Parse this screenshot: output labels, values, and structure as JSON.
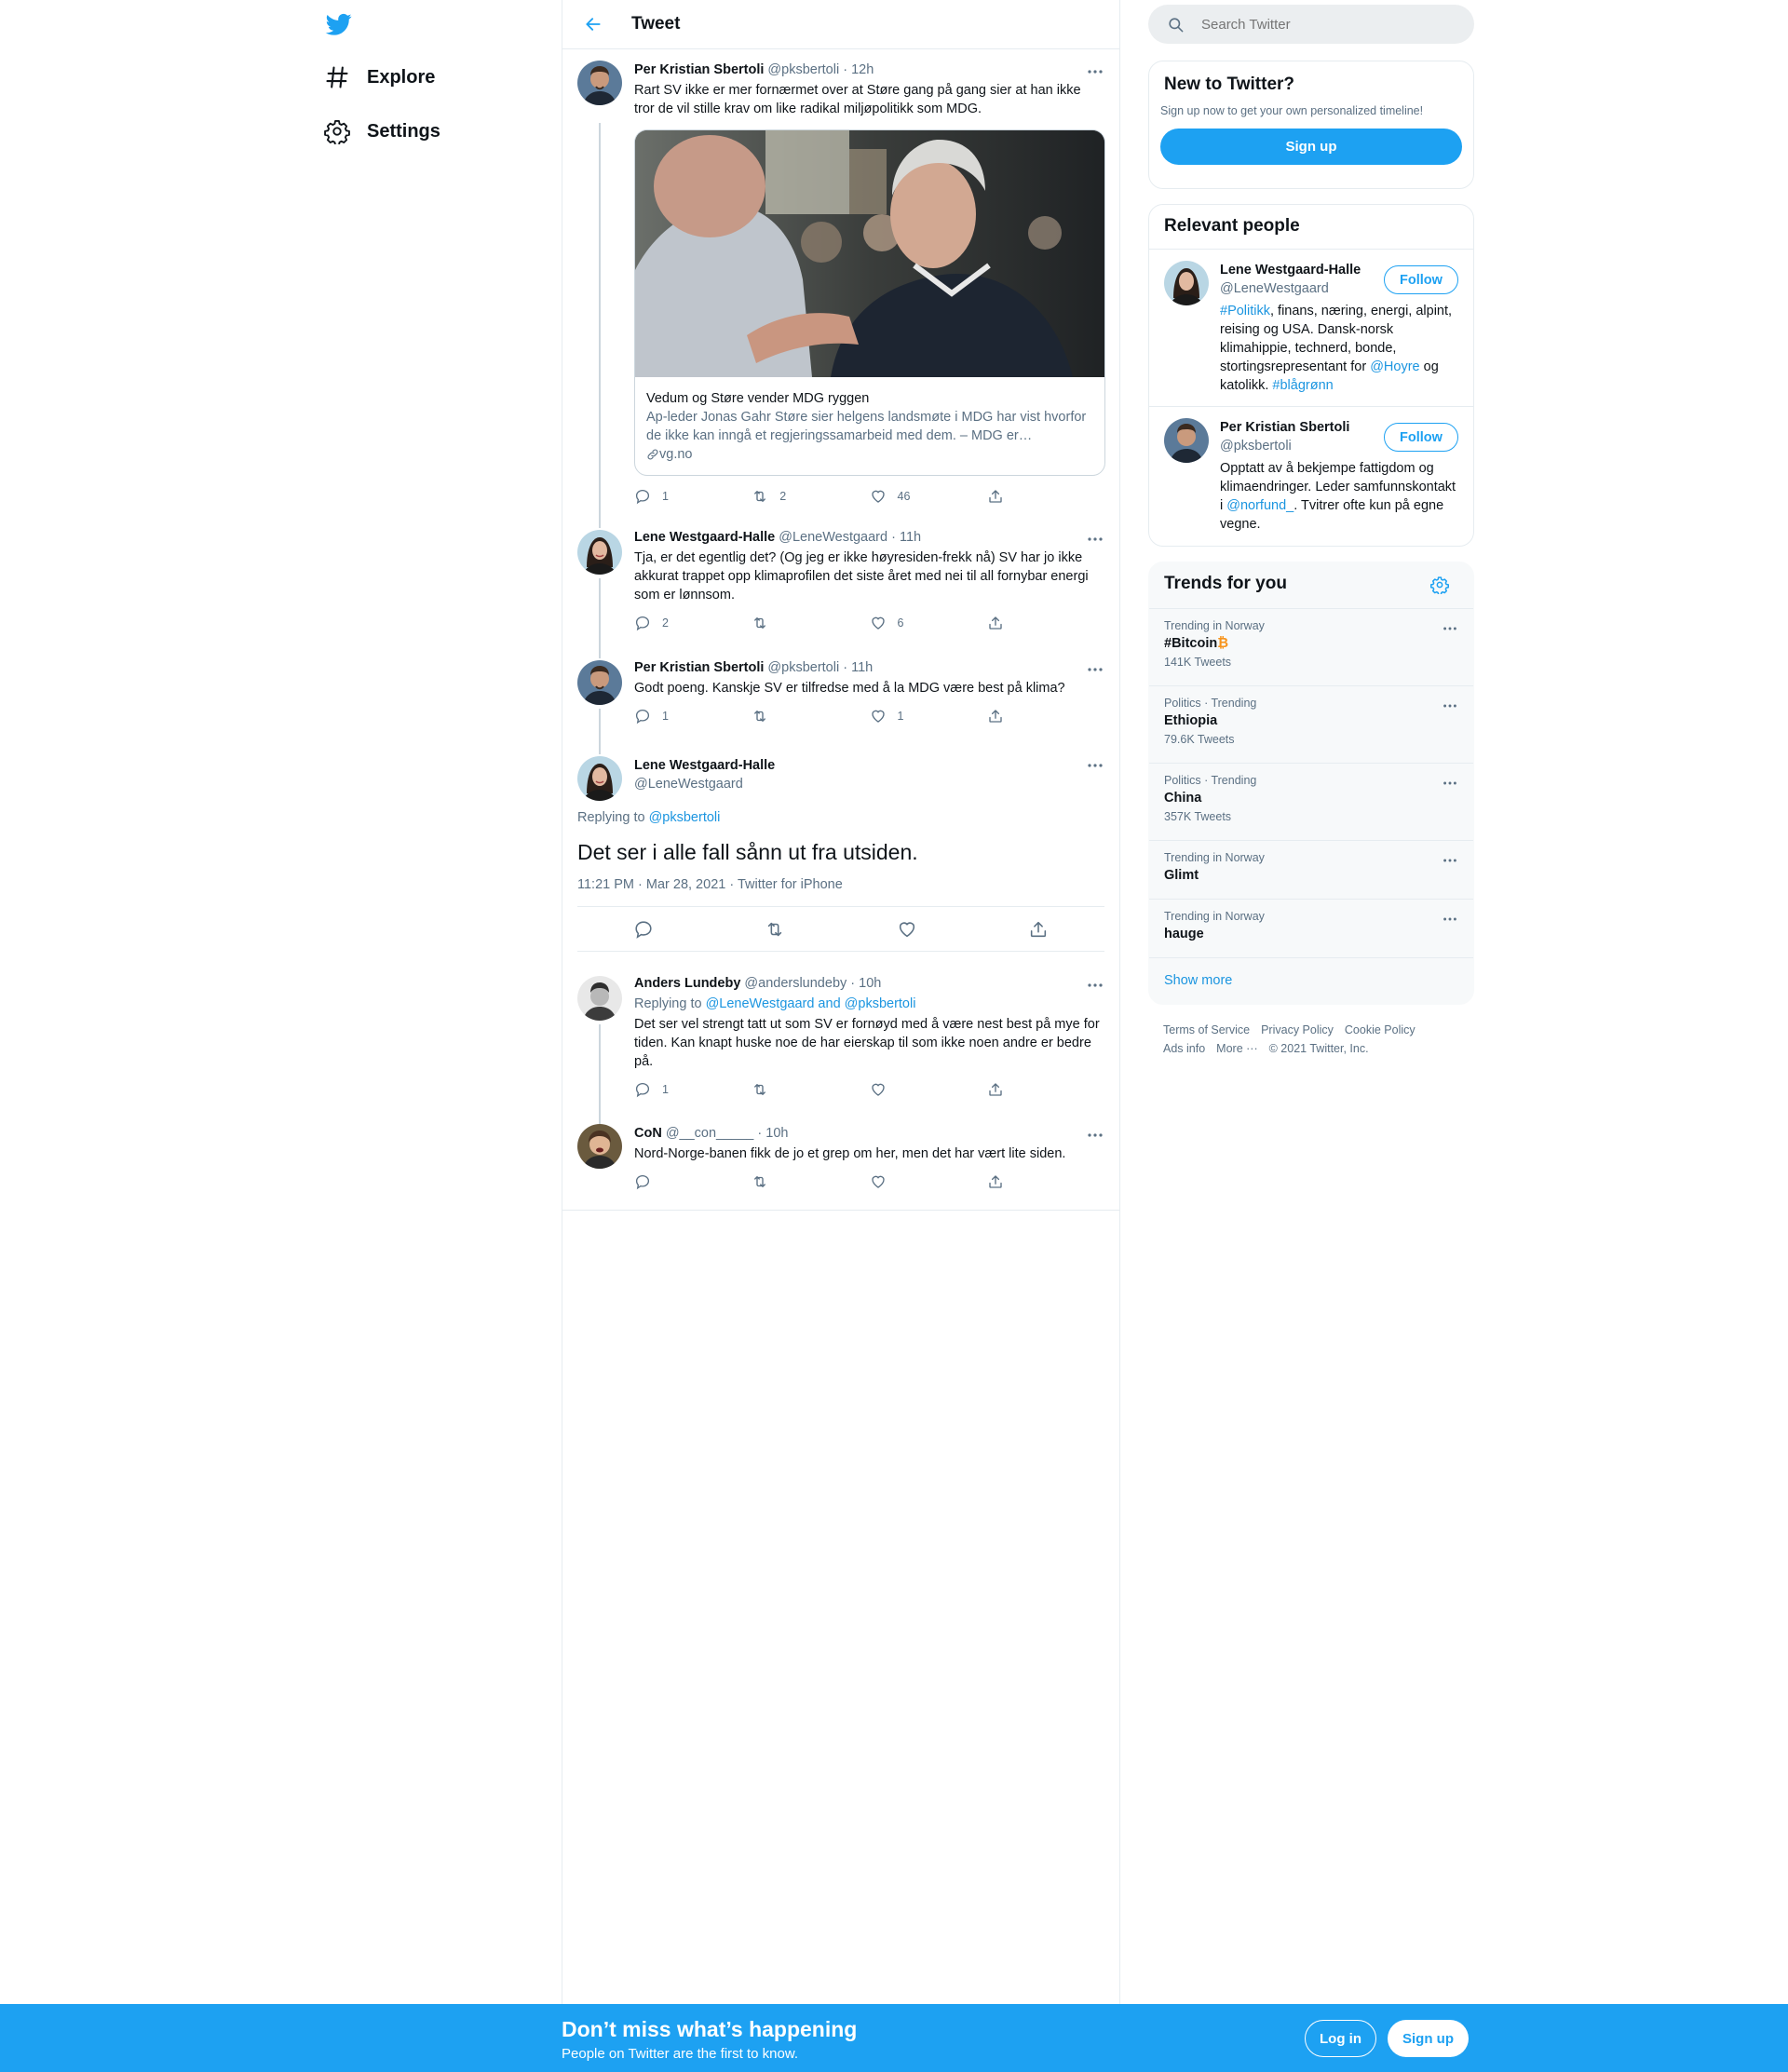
{
  "nav": {
    "logo": "twitter-bird",
    "items": [
      {
        "label": "Explore",
        "icon": "hashtag-icon"
      },
      {
        "label": "Settings",
        "icon": "gear-icon"
      }
    ]
  },
  "header": {
    "title": "Tweet"
  },
  "thread": [
    {
      "name": "Per Kristian Sbertoli",
      "handle": "@pksbertoli",
      "time": "· 12h",
      "text": "Rart SV ikke er mer fornærmet over at Støre gang på gang sier at han ikke tror de vil stille krav om like radikal miljøpolitikk som MDG.",
      "card": {
        "title": "Vedum og Støre vender MDG ryggen",
        "description": "Ap-leder Jonas Gahr Støre sier helgens landsmøte i MDG har vist hvorfor de ikke kan inngå et regjeringssamarbeid med dem. – MDG er…",
        "domain": "vg.no"
      },
      "replies": "1",
      "retweets": "2",
      "likes": "46"
    },
    {
      "name": "Lene Westgaard-Halle",
      "handle": "@LeneWestgaard",
      "time": "· 11h",
      "text": "Tja, er det egentlig det? (Og jeg er ikke høyresiden-frekk nå) SV har jo ikke akkurat trappet opp klimaprofilen det siste året med nei til all fornybar energi som er lønnsom.",
      "replies": "2",
      "retweets": "",
      "likes": "6"
    },
    {
      "name": "Per Kristian Sbertoli",
      "handle": "@pksbertoli",
      "time": "· 11h",
      "text": "Godt poeng. Kanskje SV er tilfredse med å la MDG være best på klima?",
      "replies": "1",
      "retweets": "",
      "likes": "1"
    }
  ],
  "main_tweet": {
    "name": "Lene Westgaard-Halle",
    "handle": "@LeneWestgaard",
    "replying_prefix": "Replying to",
    "replying_to": "@pksbertoli",
    "text": "Det ser i alle fall sånn ut fra utsiden.",
    "meta": "11:21 PM · Mar 28, 2021 · Twitter for iPhone"
  },
  "replies": [
    {
      "name": "Anders Lundeby",
      "handle": "@anderslundeby",
      "time": "· 10h",
      "replying_prefix": "Replying to",
      "replying_to": "@LeneWestgaard and @pksbertoli",
      "text": "Det ser vel strengt tatt ut som SV er fornøyd med å være nest best på mye for tiden. Kan knapt huske noe de har eierskap til som ikke noen andre er bedre på.",
      "replies": "1",
      "retweets": "",
      "likes": ""
    },
    {
      "name": "CoN",
      "handle": "@__con_____",
      "time": "· 10h",
      "text": "Nord-Norge-banen fikk de jo et grep om her, men det har vært lite siden.",
      "replies": "",
      "retweets": "",
      "likes": ""
    }
  ],
  "search": {
    "placeholder": "Search Twitter"
  },
  "new_to_twitter": {
    "title": "New to Twitter?",
    "subtitle": "Sign up now to get your own personalized timeline!",
    "button": "Sign up"
  },
  "relevant_people": {
    "title": "Relevant people",
    "follow_label": "Follow",
    "people": [
      {
        "name": "Lene Westgaard-Halle",
        "handle": "@LeneWestgaard",
        "bio_parts": [
          {
            "t": "#Politikk",
            "link": true
          },
          {
            "t": ", finans, næring, energi, alpint, reising og USA. Dansk-norsk klimahippie, technerd, bonde, stortingsrepresentant for ",
            "link": false
          },
          {
            "t": "@Hoyre",
            "link": true
          },
          {
            "t": " og katolikk. ",
            "link": false
          },
          {
            "t": "#blågrønn",
            "link": true
          }
        ]
      },
      {
        "name": "Per Kristian Sbertoli",
        "handle": "@pksbertoli",
        "bio_parts": [
          {
            "t": "Opptatt av å bekjempe fattigdom og klimaendringer. Leder samfunnskontakt i ",
            "link": false
          },
          {
            "t": "@norfund_",
            "link": true
          },
          {
            "t": ". Tvitrer ofte kun på egne vegne.",
            "link": false
          }
        ]
      }
    ]
  },
  "trends": {
    "title": "Trends for you",
    "items": [
      {
        "context": "Trending in Norway",
        "name": "#Bitcoin",
        "emoji": "₿",
        "count": "141K Tweets"
      },
      {
        "context": "Politics · Trending",
        "name": "Ethiopia",
        "count": "79.6K Tweets"
      },
      {
        "context": "Politics · Trending",
        "name": "China",
        "count": "357K Tweets"
      },
      {
        "context": "Trending in Norway",
        "name": "Glimt",
        "count": ""
      },
      {
        "context": "Trending in Norway",
        "name": "hauge",
        "count": ""
      }
    ],
    "show_more": "Show more"
  },
  "footer": {
    "links": [
      "Terms of Service",
      "Privacy Policy",
      "Cookie Policy",
      "Ads info",
      "More ···"
    ],
    "copyright": "© 2021 Twitter, Inc."
  },
  "bottom_bar": {
    "title": "Don’t miss what’s happening",
    "subtitle": "People on Twitter are the first to know.",
    "login": "Log in",
    "signup": "Sign up"
  },
  "colors": {
    "accent": "#1da1f2",
    "link": "#1b95e0",
    "secondary_text": "#5b7083",
    "border": "#e6ecf0"
  }
}
